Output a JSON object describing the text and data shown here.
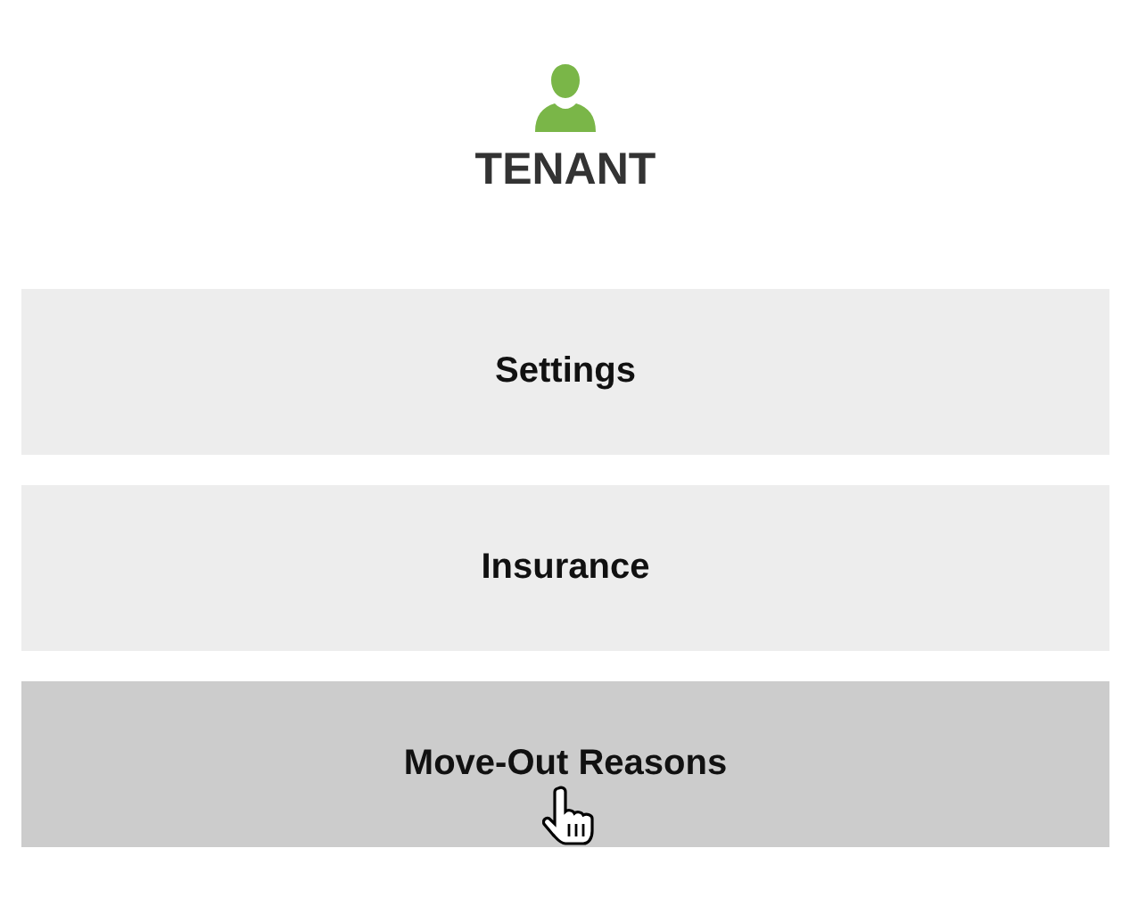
{
  "title": "TENANT",
  "items": [
    {
      "label": "Settings",
      "selected": false
    },
    {
      "label": "Insurance",
      "selected": false
    },
    {
      "label": "Move-Out Reasons",
      "selected": true
    }
  ]
}
